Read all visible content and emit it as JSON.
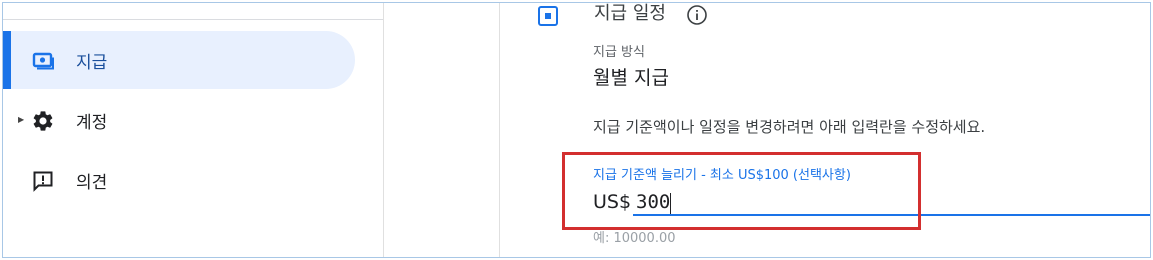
{
  "sidebar": {
    "items": [
      {
        "label": "지급",
        "icon": "payments-icon",
        "active": true
      },
      {
        "label": "계정",
        "icon": "gear-icon",
        "active": false
      },
      {
        "label": "의견",
        "icon": "feedback-icon",
        "active": false
      }
    ]
  },
  "section": {
    "title": "지급 일정",
    "icon": "schedule-icon",
    "info_icon": "info-icon"
  },
  "payment_method": {
    "label": "지급 방식",
    "value": "월별 지급"
  },
  "description": "지급 기준액이나 일정을 변경하려면 아래 입력란을 수정하세요.",
  "threshold_field": {
    "label": "지급 기준액 늘리기 - 최소 US$100 (선택사항)",
    "prefix": "US$",
    "value": "300",
    "hint": "예: 10000.00"
  },
  "colors": {
    "accent": "#1a73e8",
    "active_bg": "#e8f0fe",
    "highlight": "#d32f2f"
  }
}
